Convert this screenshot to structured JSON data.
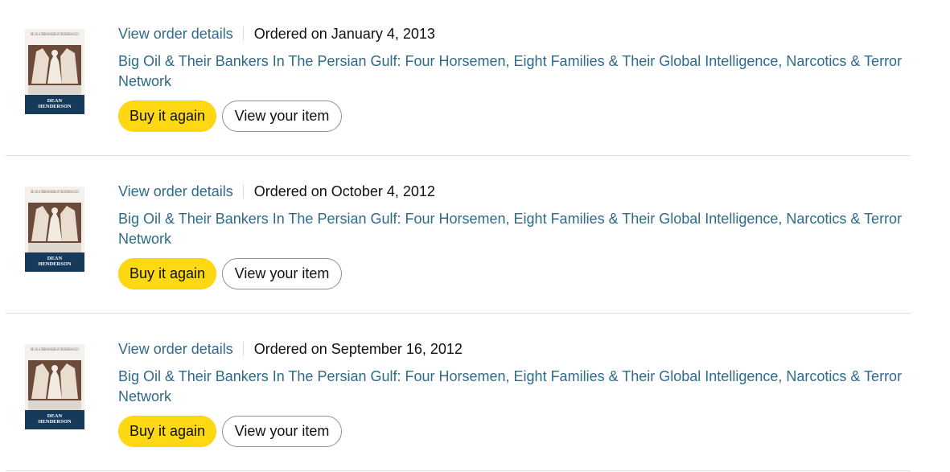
{
  "orders": [
    {
      "details_label": "View order details",
      "ordered_text": "Ordered on January 4, 2013",
      "title": "Big Oil & Their Bankers In The Persian Gulf: Four Horsemen, Eight Families & Their Global Intelligence, Narcotics & Terror Network",
      "buy_label": "Buy it again",
      "view_label": "View your item",
      "cover": {
        "title_text": "BIG OIL & THEIR BANKERS IN THE PERSIAN GULF",
        "author_line1": "DEAN",
        "author_line2": "HENDERSON"
      }
    },
    {
      "details_label": "View order details",
      "ordered_text": "Ordered on October 4, 2012",
      "title": "Big Oil & Their Bankers In The Persian Gulf: Four Horsemen, Eight Families & Their Global Intelligence, Narcotics & Terror Network",
      "buy_label": "Buy it again",
      "view_label": "View your item",
      "cover": {
        "title_text": "BIG OIL & THEIR BANKERS IN THE PERSIAN GULF",
        "author_line1": "DEAN",
        "author_line2": "HENDERSON"
      }
    },
    {
      "details_label": "View order details",
      "ordered_text": "Ordered on September 16, 2012",
      "title": "Big Oil & Their Bankers In The Persian Gulf: Four Horsemen, Eight Families & Their Global Intelligence, Narcotics & Terror Network",
      "buy_label": "Buy it again",
      "view_label": "View your item",
      "cover": {
        "title_text": "BIG OIL & THEIR BANKERS IN THE PERSIAN GULF",
        "author_line1": "DEAN",
        "author_line2": "HENDERSON"
      }
    }
  ],
  "colors": {
    "link": "#2f6a8a",
    "buy_button": "#ffd814",
    "divider": "#dddddd",
    "cover_band": "#163a5c"
  }
}
